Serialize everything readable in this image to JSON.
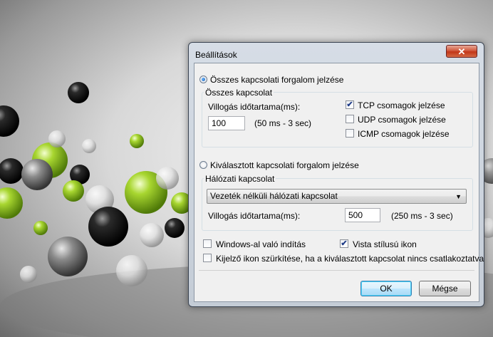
{
  "dialog": {
    "title": "Beállítások",
    "close_glyph": "✕"
  },
  "section_all": {
    "radio_label": "Összes kapcsolati forgalom jelzése",
    "radio_selected": true,
    "group_label": "Összes kapcsolat",
    "blink_label": "Villogás időtartama(ms):",
    "blink_value": "100",
    "blink_range": "(50 ms - 3 sec)",
    "checks": [
      {
        "label": "TCP csomagok jelzése",
        "checked": true
      },
      {
        "label": "UDP csomagok jelzése",
        "checked": false
      },
      {
        "label": "ICMP csomagok jelzése",
        "checked": false
      }
    ]
  },
  "section_selected": {
    "radio_label": "Kiválasztott kapcsolati forgalom jelzése",
    "radio_selected": false,
    "group_label": "Hálózati kapcsolat",
    "connection_value": "Vezeték nélküli hálózati kapcsolat",
    "blink_label": "Villogás időtartama(ms):",
    "blink_value": "500",
    "blink_range": "(250 ms - 3 sec)"
  },
  "options": {
    "windows_start": {
      "label": "Windows-al való indítás",
      "checked": false
    },
    "vista_icon": {
      "label": "Vista stílusú ikon",
      "checked": true
    },
    "gray_icon": {
      "label": "Kijelző ikon szürkítése, ha a kiválasztott kapcsolat nincs csatlakoztatva",
      "checked": false
    }
  },
  "buttons": {
    "ok": "OK",
    "cancel": "Mégse"
  },
  "icons": {
    "check_glyph": "✔",
    "dropdown_glyph": "▼"
  },
  "colors": {
    "accent_green": "#8fc31f",
    "close_red": "#c23618"
  }
}
